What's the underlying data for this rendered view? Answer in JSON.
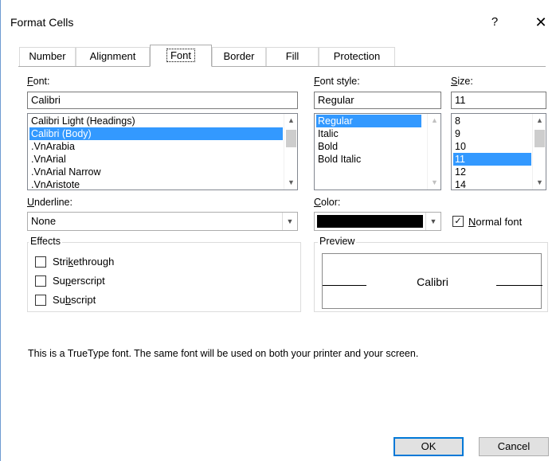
{
  "window": {
    "title": "Format Cells",
    "help": "?",
    "close": "✕"
  },
  "tabs": [
    {
      "label": "Number"
    },
    {
      "label": "Alignment"
    },
    {
      "label": "Font"
    },
    {
      "label": "Border"
    },
    {
      "label": "Fill"
    },
    {
      "label": "Protection"
    }
  ],
  "active_tab": "Font",
  "font": {
    "label": "Font:",
    "value": "Calibri",
    "items": [
      "Calibri Light (Headings)",
      "Calibri (Body)",
      ".VnArabia",
      ".VnArial",
      ".VnArial Narrow",
      ".VnAristote"
    ],
    "selected": "Calibri (Body)"
  },
  "font_style": {
    "label": "Font style:",
    "value": "Regular",
    "items": [
      "Regular",
      "Italic",
      "Bold",
      "Bold Italic"
    ],
    "selected": "Regular"
  },
  "size": {
    "label": "Size:",
    "value": "11",
    "items": [
      "8",
      "9",
      "10",
      "11",
      "12",
      "14"
    ],
    "selected": "11"
  },
  "underline": {
    "label": "Underline:",
    "value": "None"
  },
  "color": {
    "label": "Color:",
    "value": "#000000"
  },
  "normal_font": {
    "label": "Normal font",
    "checked": true
  },
  "effects": {
    "title": "Effects",
    "strikethrough": {
      "label": "Strikethrough",
      "checked": false
    },
    "superscript": {
      "label": "Superscript",
      "checked": false
    },
    "subscript": {
      "label": "Subscript",
      "checked": false
    }
  },
  "preview": {
    "title": "Preview",
    "sample": "Calibri"
  },
  "info_text": "This is a TrueType font.  The same font will be used on both your printer and your screen.",
  "buttons": {
    "ok": "OK",
    "cancel": "Cancel"
  },
  "icons": {
    "close": "close-icon",
    "help": "help-icon",
    "scroll_up": "chevron-up-icon",
    "scroll_down": "chevron-down-icon",
    "dropdown": "chevron-down-icon",
    "check": "checkmark-icon"
  }
}
